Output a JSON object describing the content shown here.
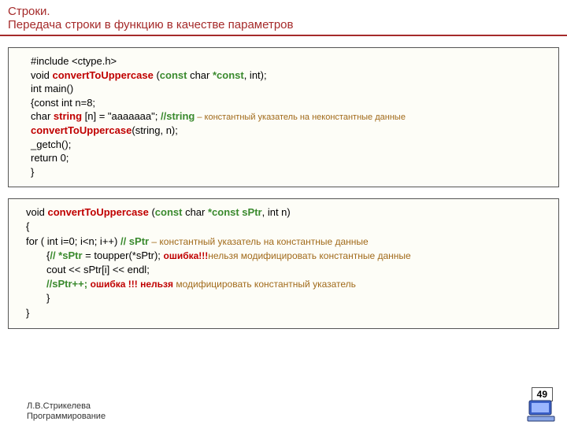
{
  "title": {
    "line1": "Строки.",
    "line2": " Передача строки в функцию в качестве параметров"
  },
  "block1": {
    "l1a": "#include <ctype.h>",
    "l2a": "void ",
    "l2b": "convertToUppercase",
    "l2c": " (",
    "l2d": "const",
    "l2e": " char ",
    "l2f": "*const",
    "l2g": ", int);",
    "l3": "int main()",
    "l4": "{const int n=8;",
    "l5a": "char ",
    "l5b": "string",
    "l5c": " [n] = \"aaaaaaa\";   ",
    "l5d": "//string",
    "l5e": " – константный указатель на неконстантные данные",
    "l6a": "convertToUppercase",
    "l6b": "(string, n);",
    "l7": "_getch();",
    "l8": "return 0;",
    "l9": "}"
  },
  "block2": {
    "l1a": "void ",
    "l1b": "convertToUppercase",
    "l1c": " (",
    "l1d": "const",
    "l1e": " char ",
    "l1f": "*const  sPtr",
    "l1g": ", int n)",
    "l2": "{",
    "l3a": "for ( int i=0; i<n; i++) ",
    "l3b": "// sPtr",
    "l3c": " – константный указатель на константные данные",
    "l4a": "{",
    "l4b": "// *sPtr",
    "l4c": " = toupper(*sPtr); ",
    "l4d": "ошибка!!!",
    "l4e": "нельзя модифицировать константные данные",
    "l5": "cout << sPtr[i] << endl;",
    "l6a": "//sPtr++;  ",
    "l6b": "ошибка !!! нельзя",
    "l6c": " модифицировать константный указатель",
    "l7": "}",
    "l8": "}"
  },
  "footer": {
    "author": "Л.В.Стрикелева",
    "course": "Программирование"
  },
  "page": "49"
}
